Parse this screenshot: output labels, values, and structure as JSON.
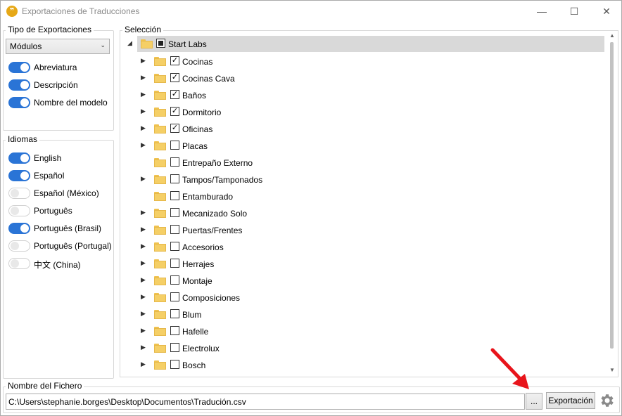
{
  "window": {
    "title": "Exportaciones de Traducciones",
    "minimize": "—",
    "maximize": "☐",
    "close": "✕"
  },
  "export_type": {
    "title": "Tipo de Exportaciones",
    "select_value": "Módulos",
    "toggles": [
      {
        "label": "Abreviatura",
        "on": true
      },
      {
        "label": "Descripción",
        "on": true
      },
      {
        "label": "Nombre del modelo",
        "on": true
      }
    ]
  },
  "languages": {
    "title": "Idiomas",
    "toggles": [
      {
        "label": "English",
        "on": true
      },
      {
        "label": "Español",
        "on": true
      },
      {
        "label": "Español (México)",
        "on": false
      },
      {
        "label": "Português",
        "on": false
      },
      {
        "label": "Português (Brasil)",
        "on": true
      },
      {
        "label": "Português (Portugal)",
        "on": false
      },
      {
        "label": "中文 (China)",
        "on": false
      }
    ]
  },
  "selection": {
    "title": "Selección",
    "root": {
      "label": "Start Labs",
      "state": "indeterminate",
      "expanded": true
    },
    "items": [
      {
        "label": "Cocinas",
        "checked": true,
        "expandable": true
      },
      {
        "label": "Cocinas Cava",
        "checked": true,
        "expandable": true
      },
      {
        "label": "Baños",
        "checked": true,
        "expandable": true
      },
      {
        "label": "Dormitorio",
        "checked": true,
        "expandable": true
      },
      {
        "label": "Oficinas",
        "checked": true,
        "expandable": true
      },
      {
        "label": "Placas",
        "checked": false,
        "expandable": true
      },
      {
        "label": "Entrepaño Externo",
        "checked": false,
        "expandable": false
      },
      {
        "label": "Tampos/Tamponados",
        "checked": false,
        "expandable": true
      },
      {
        "label": "Entamburado",
        "checked": false,
        "expandable": false
      },
      {
        "label": "Mecanizado Solo",
        "checked": false,
        "expandable": true
      },
      {
        "label": "Puertas/Frentes",
        "checked": false,
        "expandable": true
      },
      {
        "label": "Accesorios",
        "checked": false,
        "expandable": true
      },
      {
        "label": "Herrajes",
        "checked": false,
        "expandable": true
      },
      {
        "label": "Montaje",
        "checked": false,
        "expandable": true
      },
      {
        "label": "Composiciones",
        "checked": false,
        "expandable": true
      },
      {
        "label": "Blum",
        "checked": false,
        "expandable": true
      },
      {
        "label": "Hafelle",
        "checked": false,
        "expandable": true
      },
      {
        "label": "Electrolux",
        "checked": false,
        "expandable": true
      },
      {
        "label": "Bosch",
        "checked": false,
        "expandable": true
      }
    ]
  },
  "file": {
    "title": "Nombre del Fichero",
    "path": "C:\\Users\\stephanie.borges\\Desktop\\Documentos\\Tradución.csv",
    "browse_label": "...",
    "export_label": "Exportación"
  },
  "colors": {
    "accent": "#2a74d6",
    "annotation_arrow": "#e8141b",
    "selected_row": "#d9d9d9"
  },
  "icons": [
    "app-logo-icon",
    "folder-icon",
    "expand-arrow-icon",
    "settings-gear-icon",
    "red-pointer-arrow"
  ]
}
